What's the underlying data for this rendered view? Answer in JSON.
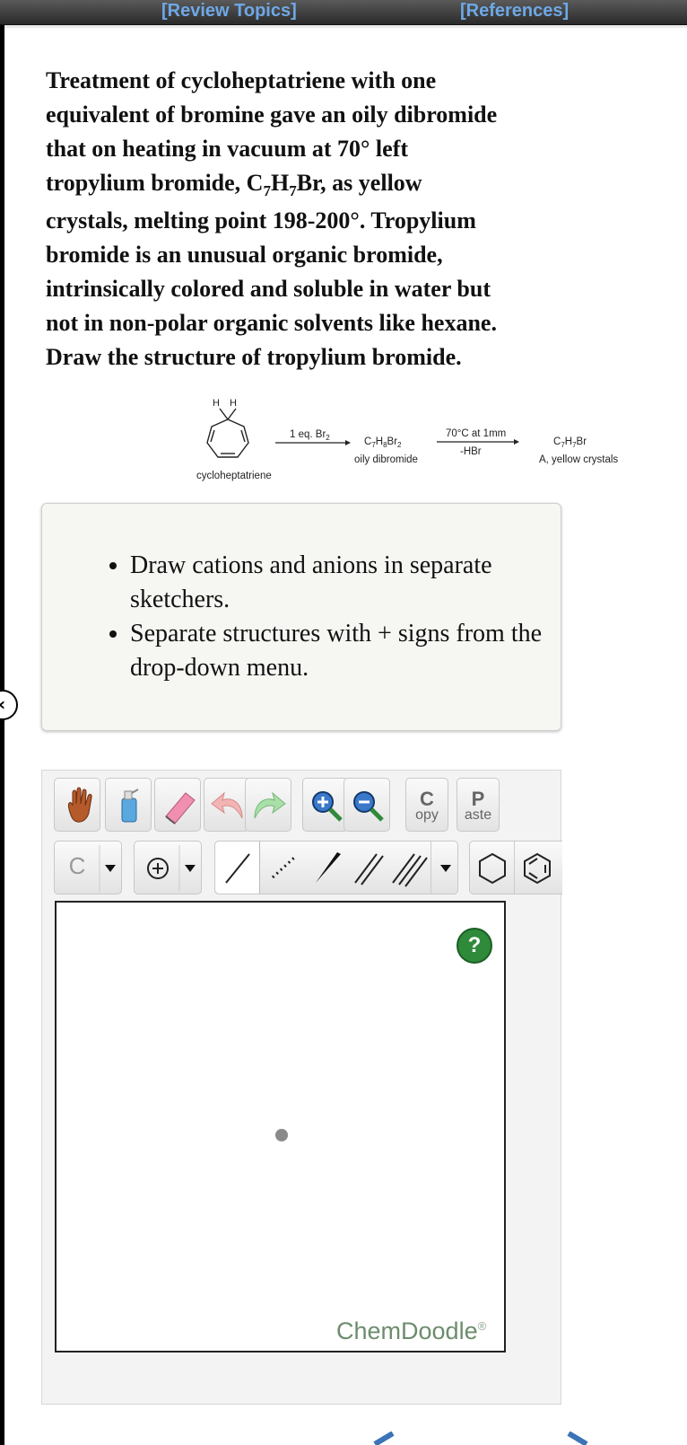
{
  "header": {
    "review_topics": "[Review Topics]",
    "references": "[References]"
  },
  "question": {
    "line1": "Treatment of cycloheptatriene with one",
    "line2": "equivalent of bromine gave an oily dibromide",
    "line3": "that on heating in vacuum at 70° left",
    "line4_pre": "tropylium bromide, C",
    "sub7a": "7",
    "line4_mid": "H",
    "sub7b": "7",
    "line4_post": "Br, as yellow",
    "line5": "crystals, melting point 198-200°. Tropylium",
    "line6": "bromide is an unusual organic bromide,",
    "line7": "intrinsically colored and soluble in water but",
    "line8": "not in non-polar organic solvents like hexane.",
    "line9": "Draw the structure of tropylium bromide."
  },
  "scheme": {
    "h_label_left": "H",
    "h_label_right": "H",
    "start_name": "cycloheptatriene",
    "reagent1": "1 eq. Br",
    "reagent1_sub": "2",
    "intermediate_c": "C",
    "intermediate_c_sub": "7",
    "intermediate_h": "H",
    "intermediate_h_sub": "8",
    "intermediate_br": "Br",
    "intermediate_br_sub": "2",
    "intermediate_name": "oily dibromide",
    "condition_top": "70°C at 1mm",
    "condition_bottom": "-HBr",
    "product_c": "C",
    "product_c_sub": "7",
    "product_h": "H",
    "product_h_sub": "7",
    "product_br": "Br",
    "product_name": "A, yellow crystals"
  },
  "instructions": [
    "Draw cations and anions in separate sketchers.",
    "Separate structures with + signs from the drop-down menu."
  ],
  "toolbar": {
    "copy_top": "C",
    "copy_bottom": "opy",
    "paste_top": "P",
    "paste_bottom": "aste",
    "element_label": "C",
    "help_label": "?",
    "brand": "ChemDoodle",
    "brand_mark": "®"
  },
  "colors": {
    "link": "#6ea8e6",
    "help_green": "#2f8a3a",
    "brand_green": "#6d8c6d"
  }
}
